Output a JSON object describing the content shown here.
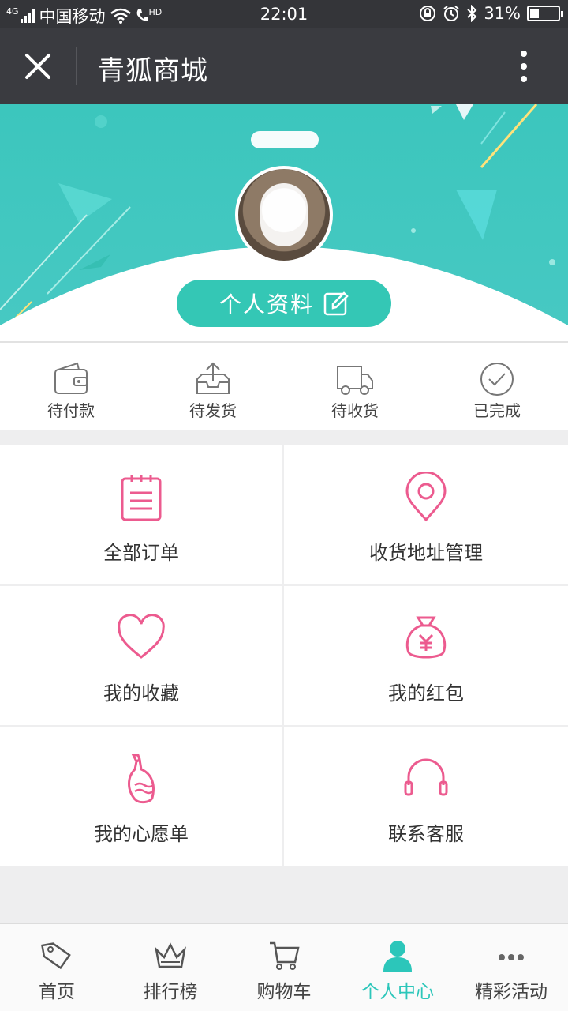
{
  "status_bar": {
    "network_type": "4G",
    "carrier": "中国移动",
    "hd_label": "HD",
    "time": "22:01",
    "battery_percent": "31%",
    "battery_level": 0.31
  },
  "title_bar": {
    "title": "青狐商城"
  },
  "profile": {
    "button_label": "个人资料"
  },
  "order_status": [
    {
      "label": "待付款",
      "icon": "wallet-icon"
    },
    {
      "label": "待发货",
      "icon": "package-upload-icon"
    },
    {
      "label": "待收货",
      "icon": "delivery-truck-icon"
    },
    {
      "label": "已完成",
      "icon": "check-circle-icon"
    }
  ],
  "menu": [
    {
      "label": "全部订单",
      "icon": "clipboard-list-icon"
    },
    {
      "label": "收货地址管理",
      "icon": "location-pin-icon"
    },
    {
      "label": "我的收藏",
      "icon": "heart-icon"
    },
    {
      "label": "我的红包",
      "icon": "money-bag-icon"
    },
    {
      "label": "我的心愿单",
      "icon": "wish-bottle-icon"
    },
    {
      "label": "联系客服",
      "icon": "headphones-icon"
    }
  ],
  "bottom_nav": [
    {
      "label": "首页",
      "icon": "tag-icon",
      "active": false
    },
    {
      "label": "排行榜",
      "icon": "crown-icon",
      "active": false
    },
    {
      "label": "购物车",
      "icon": "cart-icon",
      "active": false
    },
    {
      "label": "个人中心",
      "icon": "user-icon",
      "active": true
    },
    {
      "label": "精彩活动",
      "icon": "more-dots-icon",
      "active": false
    }
  ],
  "colors": {
    "accent": "#2cc6ba",
    "header_bg": "#45c8c2",
    "icon_pink": "#ec5b8f",
    "status_bar_bg": "#343539",
    "title_bar_bg": "#3a3b40"
  }
}
